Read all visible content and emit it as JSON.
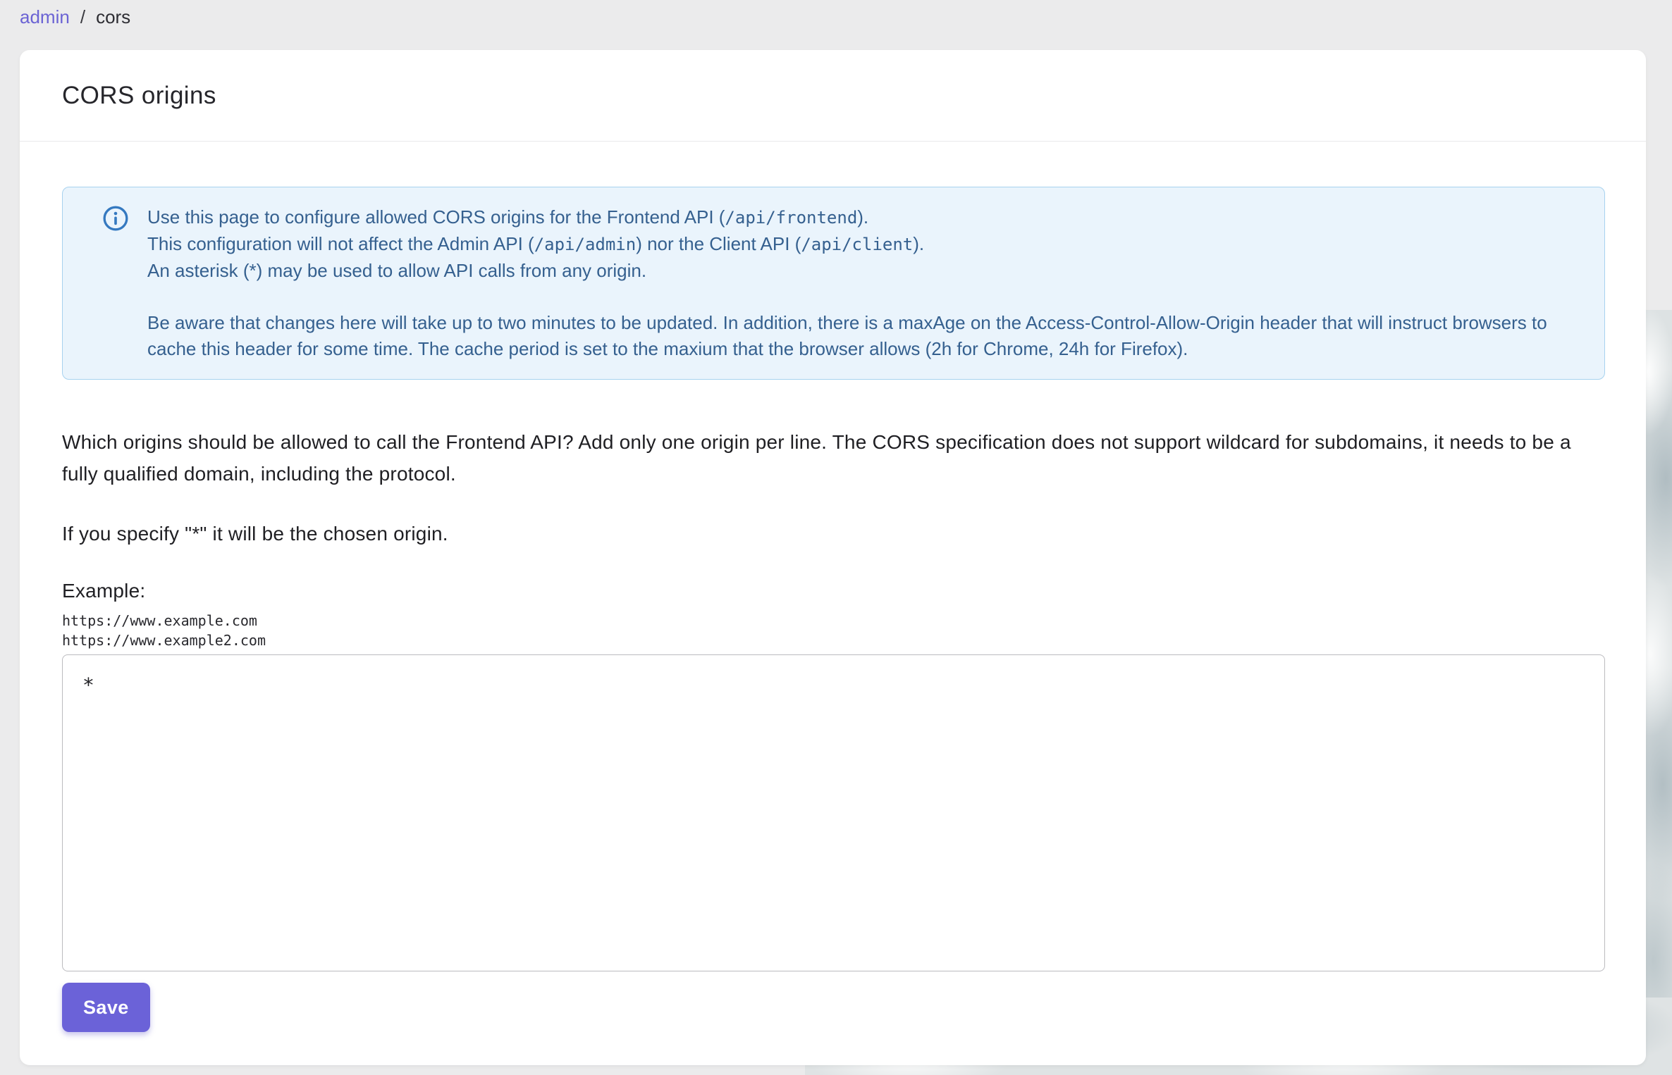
{
  "colors": {
    "accent": "#6b62d8",
    "breadcrumb_link": "#6b63d4",
    "info_background": "#eaf4fc",
    "info_border": "#a7d2ef",
    "info_text": "#35608f",
    "info_icon_blue": "#3579c0",
    "page_background": "#ebebec",
    "card_background": "#ffffff"
  },
  "breadcrumb": {
    "admin": "admin",
    "separator": "/",
    "current": "cors"
  },
  "card": {
    "title": "CORS origins"
  },
  "info_box": {
    "icon": "info-circle-icon",
    "line1": {
      "pre": "Use this page to configure allowed CORS origins for the Frontend API (",
      "code": "/api/frontend",
      "post": ")."
    },
    "line2": {
      "pre": "This configuration will not affect the Admin API (",
      "code1": "/api/admin",
      "mid": ") nor the Client API (",
      "code2": "/api/client",
      "post": ")."
    },
    "line3": "An asterisk (*) may be used to allow API calls from any origin.",
    "paragraph2": "Be aware that changes here will take up to two minutes to be updated. In addition, there is a maxAge on the Access-Control-Allow-Origin header that will instruct browsers to cache this header for some time. The cache period is set to the maxium that the browser allows (2h for Chrome, 24h for Firefox)."
  },
  "description": {
    "paragraph1": "Which origins should be allowed to call the Frontend API? Add only one origin per line. The CORS specification does not support wildcard for subdomains, it needs to be a fully qualified domain, including the protocol.",
    "paragraph2": "If you specify \"*\" it will be the chosen origin.",
    "example_label": "Example:",
    "example_lines": "https://www.example.com\nhttps://www.example2.com"
  },
  "form": {
    "textarea_value": "*",
    "save_label": "Save"
  }
}
